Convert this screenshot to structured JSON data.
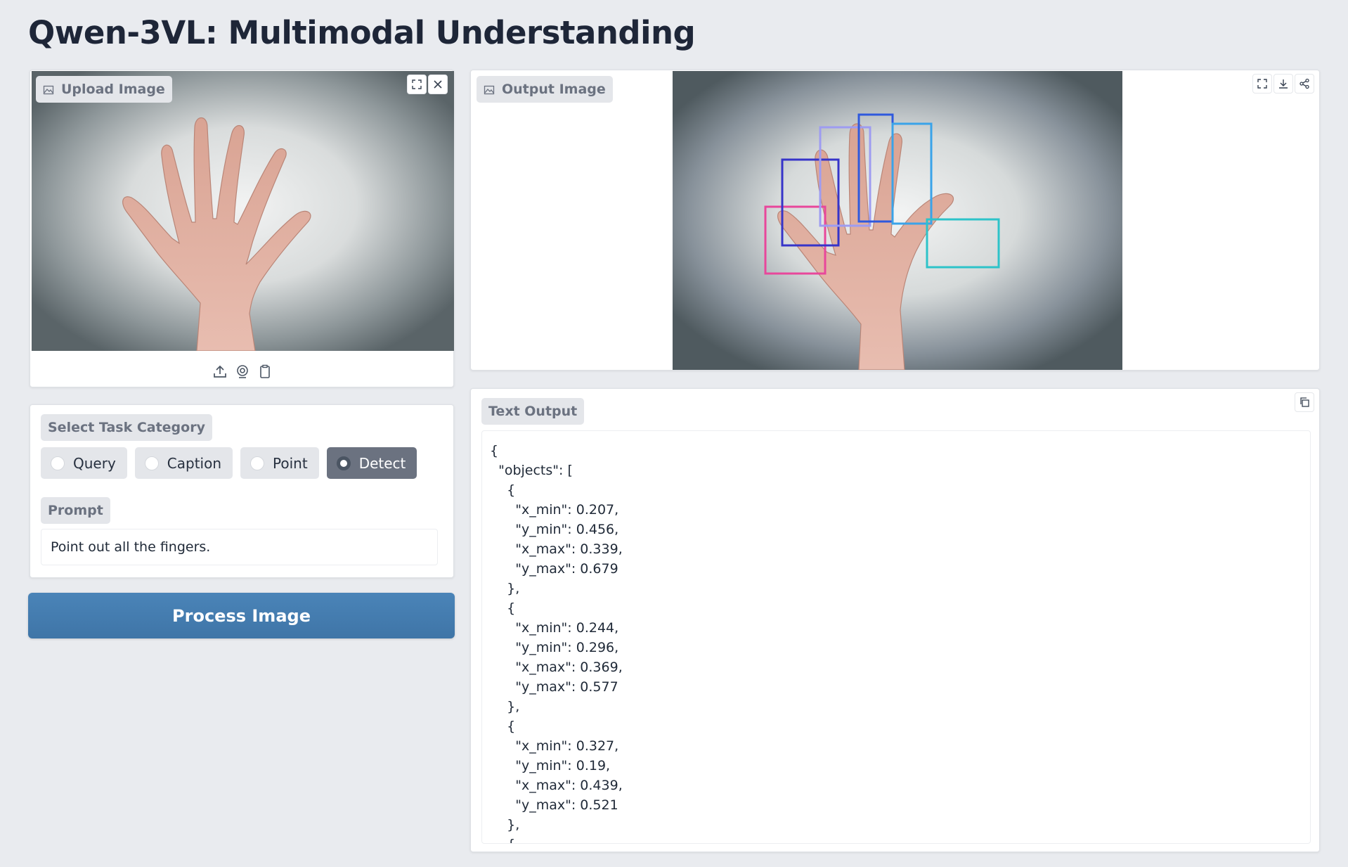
{
  "app": {
    "title": "Qwen-3VL: Multimodal Understanding"
  },
  "upload": {
    "label": "Upload Image",
    "icons": [
      "image-icon",
      "fullscreen-icon",
      "close-icon",
      "upload-icon",
      "webcam-icon",
      "clipboard-icon"
    ]
  },
  "output_image": {
    "label": "Output Image",
    "icons": [
      "image-icon",
      "fullscreen-icon",
      "download-icon",
      "share-icon"
    ],
    "box_colors": [
      "#e8479b",
      "#3634c9",
      "#9e9cf1",
      "#2f59dd",
      "#3aa3e9",
      "#2dc3c9"
    ]
  },
  "task": {
    "label": "Select Task Category",
    "options": [
      "Query",
      "Caption",
      "Point",
      "Detect"
    ],
    "selected": "Detect"
  },
  "prompt": {
    "label": "Prompt",
    "value": "Point out all the fingers."
  },
  "process_button": {
    "label": "Process Image"
  },
  "text_output": {
    "label": "Text Output",
    "lines": [
      "{",
      "  \"objects\": [",
      "    {",
      "      \"x_min\": 0.207,",
      "      \"y_min\": 0.456,",
      "      \"x_max\": 0.339,",
      "      \"y_max\": 0.679",
      "    },",
      "    {",
      "      \"x_min\": 0.244,",
      "      \"y_min\": 0.296,",
      "      \"x_max\": 0.369,",
      "      \"y_max\": 0.577",
      "    },",
      "    {",
      "      \"x_min\": 0.327,",
      "      \"y_min\": 0.19,",
      "      \"x_max\": 0.439,",
      "      \"y_max\": 0.521",
      "    },",
      "    {"
    ]
  }
}
